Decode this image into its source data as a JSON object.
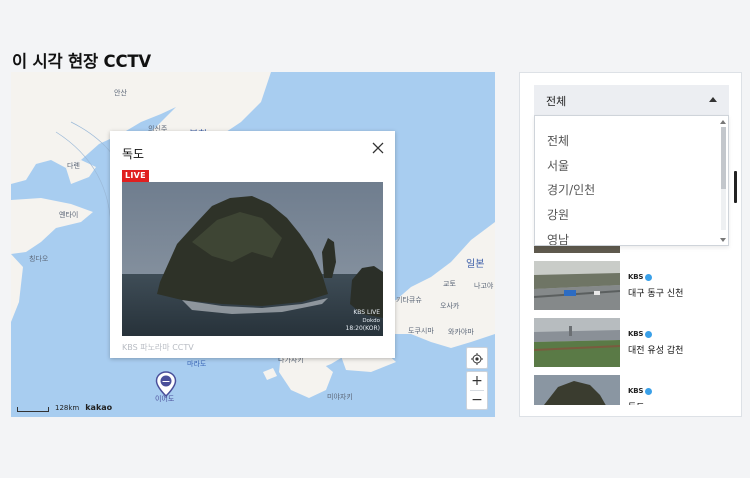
{
  "page": {
    "title": "이 시각 현장 CCTV"
  },
  "map": {
    "labels": {
      "ansan": "안산",
      "sinuiju": "의신주",
      "north_korea": "북한",
      "dalian": "다롄",
      "yantai": "옌타이",
      "qingdao": "칭다오",
      "japan": "일본",
      "nagoya": "나고야",
      "kyoto": "교토",
      "osaka": "오사카",
      "kitakyushu": "키타큐슈",
      "tokushima": "도쿠시마",
      "wakayama": "와카야마",
      "nagasaki": "나가사키",
      "miyazaki": "미야자키",
      "marado": "마라도",
      "iodo": "이어도",
      "shanghai": "상하이",
      "hiroshima": "히로시마"
    },
    "scale_text": "128km",
    "brand": "kakao",
    "zoom_in": "+",
    "zoom_out": "−"
  },
  "popup": {
    "title": "독도",
    "live_label": "LIVE",
    "caption": "KBS 파노라마 CCTV",
    "video_overlay": [
      "KBS LIVE",
      "Dokdo",
      "18:20(KOR)"
    ]
  },
  "panel": {
    "select": {
      "selected": "전체",
      "options": [
        "전체",
        "서울",
        "경기/인천",
        "강원",
        "영남"
      ]
    },
    "items": [
      {
        "name": "대구 동구 신천",
        "logo": "KBS"
      },
      {
        "name": "대전 유성 갑천",
        "logo": "KBS"
      },
      {
        "name": "독도",
        "logo": "KBS"
      }
    ]
  },
  "colors": {
    "sea": "#a8cdf0",
    "land": "#f5f3ef",
    "live_red": "#e02020",
    "kbs_blue": "#3aa0e8"
  }
}
